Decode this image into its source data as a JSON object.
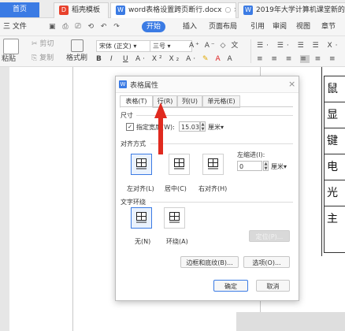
{
  "tabs": [
    {
      "label": "首页",
      "badge": ""
    },
    {
      "label": "稻壳模板",
      "badge": "D"
    },
    {
      "label": "word表格设置跨页断行.docx",
      "badge": "W"
    },
    {
      "label": "2019年大学计算机课堂新的...",
      "badge": "W"
    }
  ],
  "menu": {
    "items": [
      "三 文件",
      "开始",
      "插入",
      "页面布局",
      "引用",
      "审阅",
      "视图",
      "章节"
    ]
  },
  "ribbon": {
    "paste": "粘贴",
    "cut": "剪切",
    "copy": "复制",
    "format_painter": "格式刷",
    "font": "宋体 (正文)",
    "size": "三号",
    "bold": "B",
    "italic": "I",
    "underline": "U"
  },
  "doc": {
    "cells": [
      "鼠",
      "显",
      "键",
      "电",
      "光",
      "主"
    ]
  },
  "dialog": {
    "title": "表格属性",
    "close": "×",
    "tabs": [
      "表格(T)",
      "行(R)",
      "列(U)",
      "单元格(E)"
    ],
    "size_section": "尺寸",
    "specify_width": "指定宽度(W):",
    "width_value": "15.03",
    "width_unit": "厘米▾",
    "align_section": "对齐方式",
    "align_options": [
      "左对齐(L)",
      "居中(C)",
      "右对齐(H)"
    ],
    "indent_label": "左缩进(I):",
    "indent_value": "0",
    "indent_unit": "厘米▾",
    "wrap_section": "文字环绕",
    "wrap_options": [
      "无(N)",
      "环绕(A)"
    ],
    "position_button": "定位(P)...",
    "border_button": "边框和底纹(B)...",
    "options_button": "选项(O)...",
    "ok": "确定",
    "cancel": "取消"
  }
}
